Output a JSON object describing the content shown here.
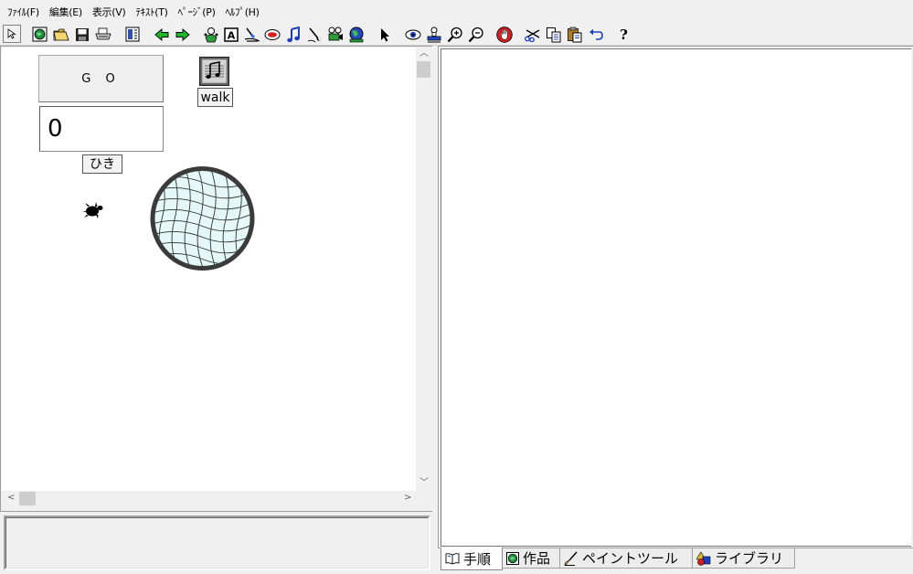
{
  "menu": [
    {
      "label": "ﾌｧｲﾙ(F)"
    },
    {
      "label": "編集(E)"
    },
    {
      "label": "表示(V)"
    },
    {
      "label": "ﾃｷｽﾄ(T)"
    },
    {
      "label": "ﾍﾟｰｼﾞ(P)"
    },
    {
      "label": "ﾍﾙﾌﾟ(H)"
    }
  ],
  "toolbar": {
    "help_glyph": "?",
    "text_glyph": "A",
    "icons": [
      "pointer-small-icon",
      "globe-icon",
      "open-folder-icon",
      "save-icon",
      "print-icon",
      "layout-icon",
      "back-arrow-icon",
      "forward-arrow-icon",
      "character-icon",
      "text-tool-icon",
      "paint-icon",
      "button-tool-icon",
      "music-icon",
      "pen-icon",
      "movie-icon",
      "world-icon",
      "arrow-cursor-icon",
      "eye-icon",
      "stamp-icon",
      "zoom-in-icon",
      "zoom-out-icon",
      "hand-stop-icon",
      "scissors-icon",
      "copy-icon",
      "paste-icon",
      "undo-icon",
      "help-icon"
    ]
  },
  "stage": {
    "go_button_label": "G O",
    "counter_value": "0",
    "counter_label": "ひき",
    "sound_label": "walk"
  },
  "tabs": [
    {
      "label": "手順",
      "icon": "book-icon",
      "active": true
    },
    {
      "label": "作品",
      "icon": "globe-icon",
      "active": false
    },
    {
      "label": "ペイントツール",
      "icon": "brush-icon",
      "active": false
    },
    {
      "label": "ライブラリ",
      "icon": "shapes-icon",
      "active": false
    }
  ],
  "colors": {
    "canvas": "#ffffff",
    "chrome": "#f0f0f0",
    "net_fill": "#e4f8f8",
    "net_stroke": "#333333"
  }
}
